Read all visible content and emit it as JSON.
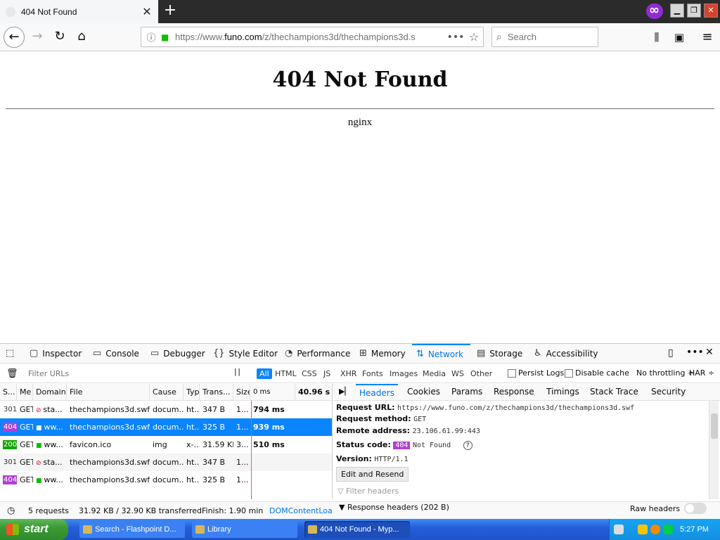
{
  "browser": {
    "tab_title": "404 Not Found",
    "url_prefix": "https://www.",
    "url_host": "funo.com",
    "url_rest": "/z/thechampions3d/thechampions3d.s",
    "search_placeholder": "Search"
  },
  "page": {
    "heading": "404 Not Found",
    "server": "nginx"
  },
  "devtools": {
    "tabs": [
      {
        "label": "Inspector",
        "icon": "inspector-icon"
      },
      {
        "label": "Console",
        "icon": "console-icon"
      },
      {
        "label": "Debugger",
        "icon": "debugger-icon"
      },
      {
        "label": "Style Editor",
        "icon": "style-editor-icon"
      },
      {
        "label": "Performance",
        "icon": "performance-icon"
      },
      {
        "label": "Memory",
        "icon": "memory-icon"
      },
      {
        "label": "Network",
        "icon": "network-icon"
      },
      {
        "label": "Storage",
        "icon": "storage-icon"
      },
      {
        "label": "Accessibility",
        "icon": "accessibility-icon"
      }
    ],
    "active_tab": "Network",
    "filter_placeholder": "Filter URLs",
    "type_filters": [
      "All",
      "HTML",
      "CSS",
      "JS",
      "XHR",
      "Fonts",
      "Images",
      "Media",
      "WS",
      "Other"
    ],
    "persist_logs": "Persist Logs",
    "disable_cache": "Disable cache",
    "throttling": "No throttling ÷",
    "har": "HAR ÷",
    "columns": [
      "S...",
      "Me",
      "Domain",
      "File",
      "Cause",
      "Typ",
      "Trans...",
      "Size",
      "0 ms",
      "40.96 s"
    ],
    "requests": [
      {
        "status": "301",
        "method": "GET",
        "domain": "sta...",
        "file": "thechampions3d.swf",
        "cause": "docum...",
        "type": "ht...",
        "transferred": "347 B",
        "size": "1...",
        "timing": "794 ms",
        "secure": false
      },
      {
        "status": "404",
        "method": "GET",
        "domain": "ww...",
        "file": "thechampions3d.swf",
        "cause": "docum...",
        "type": "ht...",
        "transferred": "325 B",
        "size": "1...",
        "timing": "939 ms",
        "secure": true
      },
      {
        "status": "200",
        "method": "GET",
        "domain": "ww...",
        "file": "favicon.ico",
        "cause": "img",
        "type": "x-...",
        "transferred": "31.59 KB",
        "size": "3...",
        "timing": "510 ms",
        "secure": true
      },
      {
        "status": "301",
        "method": "GET",
        "domain": "sta...",
        "file": "thechampions3d.swf",
        "cause": "docum...",
        "type": "ht...",
        "transferred": "347 B",
        "size": "1...",
        "timing": "",
        "secure": false
      },
      {
        "status": "404",
        "method": "GET",
        "domain": "ww...",
        "file": "thechampions3d.swf",
        "cause": "docum...",
        "type": "ht...",
        "transferred": "325 B",
        "size": "1...",
        "timing": "",
        "secure": true
      }
    ],
    "detail_tabs": [
      "Headers",
      "Cookies",
      "Params",
      "Response",
      "Timings",
      "Stack Trace",
      "Security"
    ],
    "details": {
      "request_url_label": "Request URL:",
      "request_url": "https://www.funo.com/z/thechampions3d/thechampions3d.swf",
      "request_method_label": "Request method:",
      "request_method": "GET",
      "remote_address_label": "Remote address:",
      "remote_address": "23.106.61.99:443",
      "status_code_label": "Status code:",
      "status_code": "404",
      "status_text": "Not Found",
      "version_label": "Version:",
      "version": "HTTP/1.1",
      "edit_resend": "Edit and Resend",
      "filter_headers": "Filter headers",
      "response_headers": "Response headers (202 B)",
      "raw_headers": "Raw headers"
    },
    "status": {
      "requests": "5 requests",
      "transferred": "31.92 KB / 32.90 KB transferred",
      "finish": "Finish: 1.90 min",
      "dom_loaded": "DOMContentLoade"
    }
  },
  "taskbar": {
    "start": "start",
    "tasks": [
      "Search - Flashpoint D...",
      "Library",
      "404 Not Found - Myp..."
    ],
    "clock": "5:27 PM"
  }
}
